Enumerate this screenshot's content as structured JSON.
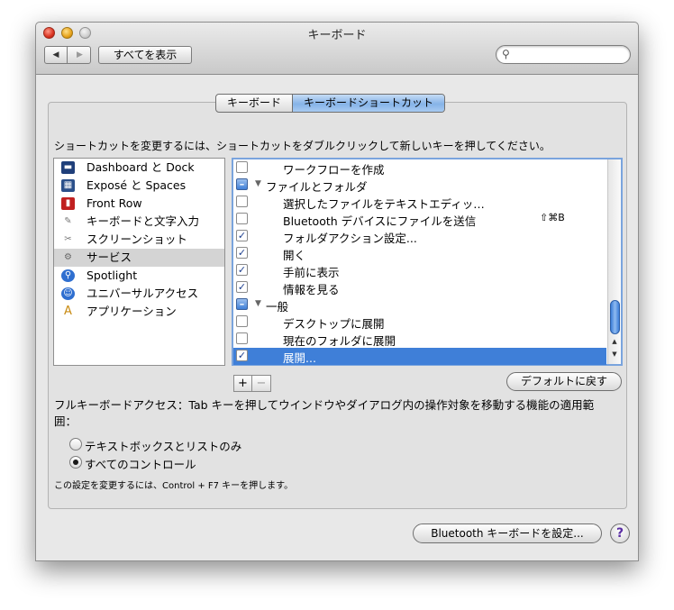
{
  "window": {
    "title": "キーボード"
  },
  "toolbar": {
    "back_glyph": "◀",
    "forward_glyph": "▶",
    "show_all": "すべてを表示",
    "search_placeholder": ""
  },
  "tabs": [
    {
      "label": "キーボード",
      "selected": false
    },
    {
      "label": "キーボードショートカット",
      "selected": true
    }
  ],
  "instruction": "ショートカットを変更するには、ショートカットをダブルクリックして新しいキーを押してください。",
  "categories": [
    {
      "label": "Dashboard と Dock",
      "icon": "dashboard-dock-icon",
      "selected": false
    },
    {
      "label": "Exposé と Spaces",
      "icon": "expose-spaces-icon",
      "selected": false
    },
    {
      "label": "Front Row",
      "icon": "front-row-icon",
      "selected": false
    },
    {
      "label": "キーボードと文字入力",
      "icon": "keyboard-input-icon",
      "selected": false
    },
    {
      "label": "スクリーンショット",
      "icon": "screenshot-icon",
      "selected": false
    },
    {
      "label": "サービス",
      "icon": "services-gear-icon",
      "selected": true
    },
    {
      "label": "Spotlight",
      "icon": "spotlight-icon",
      "selected": false
    },
    {
      "label": "ユニバーサルアクセス",
      "icon": "universal-access-icon",
      "selected": false
    },
    {
      "label": "アプリケーション",
      "icon": "applications-icon",
      "selected": false
    }
  ],
  "shortcuts": [
    {
      "label": "ワークフローを作成",
      "check": "unchecked",
      "type": "item",
      "shortcut": "",
      "selected": false
    },
    {
      "label": "ファイルとフォルダ",
      "check": "mixed",
      "type": "group",
      "shortcut": "",
      "selected": false
    },
    {
      "label": "選択したファイルをテキストエディッ…",
      "check": "unchecked",
      "type": "item",
      "shortcut": "",
      "selected": false
    },
    {
      "label": "Bluetooth デバイスにファイルを送信",
      "check": "unchecked",
      "type": "item",
      "shortcut": "⇧⌘B",
      "selected": false
    },
    {
      "label": "フォルダアクション設定...",
      "check": "checked",
      "type": "item",
      "shortcut": "",
      "selected": false
    },
    {
      "label": "開く",
      "check": "checked",
      "type": "item",
      "shortcut": "",
      "selected": false
    },
    {
      "label": "手前に表示",
      "check": "checked",
      "type": "item",
      "shortcut": "",
      "selected": false
    },
    {
      "label": "情報を見る",
      "check": "checked",
      "type": "item",
      "shortcut": "",
      "selected": false
    },
    {
      "label": "一般",
      "check": "mixed",
      "type": "group",
      "shortcut": "",
      "selected": false
    },
    {
      "label": "デスクトップに展開",
      "check": "unchecked",
      "type": "item",
      "shortcut": "",
      "selected": false
    },
    {
      "label": "現在のフォルダに展開",
      "check": "unchecked",
      "type": "item",
      "shortcut": "",
      "selected": false
    },
    {
      "label": "展開...",
      "check": "checked",
      "type": "item",
      "shortcut": "",
      "selected": true
    }
  ],
  "list_controls": {
    "add": "+",
    "remove": "−"
  },
  "restore_defaults": "デフォルトに戻す",
  "full_keyboard_access": {
    "description": "フルキーボードアクセス：Tab キーを押してウインドウやダイアログ内の操作対象を移動する機能の適用範囲：",
    "options": [
      {
        "label": "テキストボックスとリストのみ",
        "selected": false
      },
      {
        "label": "すべてのコントロール",
        "selected": true
      }
    ],
    "note": "この設定を変更するには、Control + F7 キーを押します。"
  },
  "bluetooth_button": "Bluetooth キーボードを設定...",
  "help": "?"
}
